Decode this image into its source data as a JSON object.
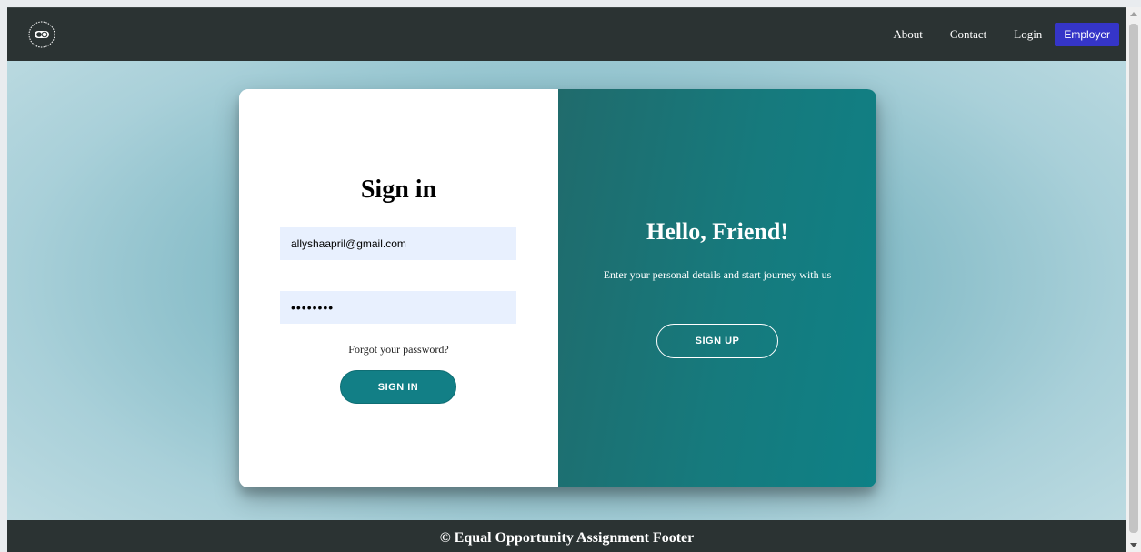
{
  "navbar": {
    "logo_icon": "equal-opportunity-logo-icon",
    "links": [
      {
        "label": "About"
      },
      {
        "label": "Contact"
      },
      {
        "label": "Login"
      }
    ],
    "employer_label": "Employer",
    "employer_color": "#3535c8"
  },
  "signin": {
    "title": "Sign in",
    "email_value": "allyshaapril@gmail.com",
    "password_value": "••••••••",
    "forgot_label": "Forgot your password?",
    "button_label": "SIGN IN",
    "accent_color": "#127f86"
  },
  "welcome": {
    "title": "Hello, Friend!",
    "text": "Enter your personal details and start journey with us",
    "button_label": "SIGN UP"
  },
  "footer": {
    "text": "© Equal Opportunity Assignment Footer"
  }
}
